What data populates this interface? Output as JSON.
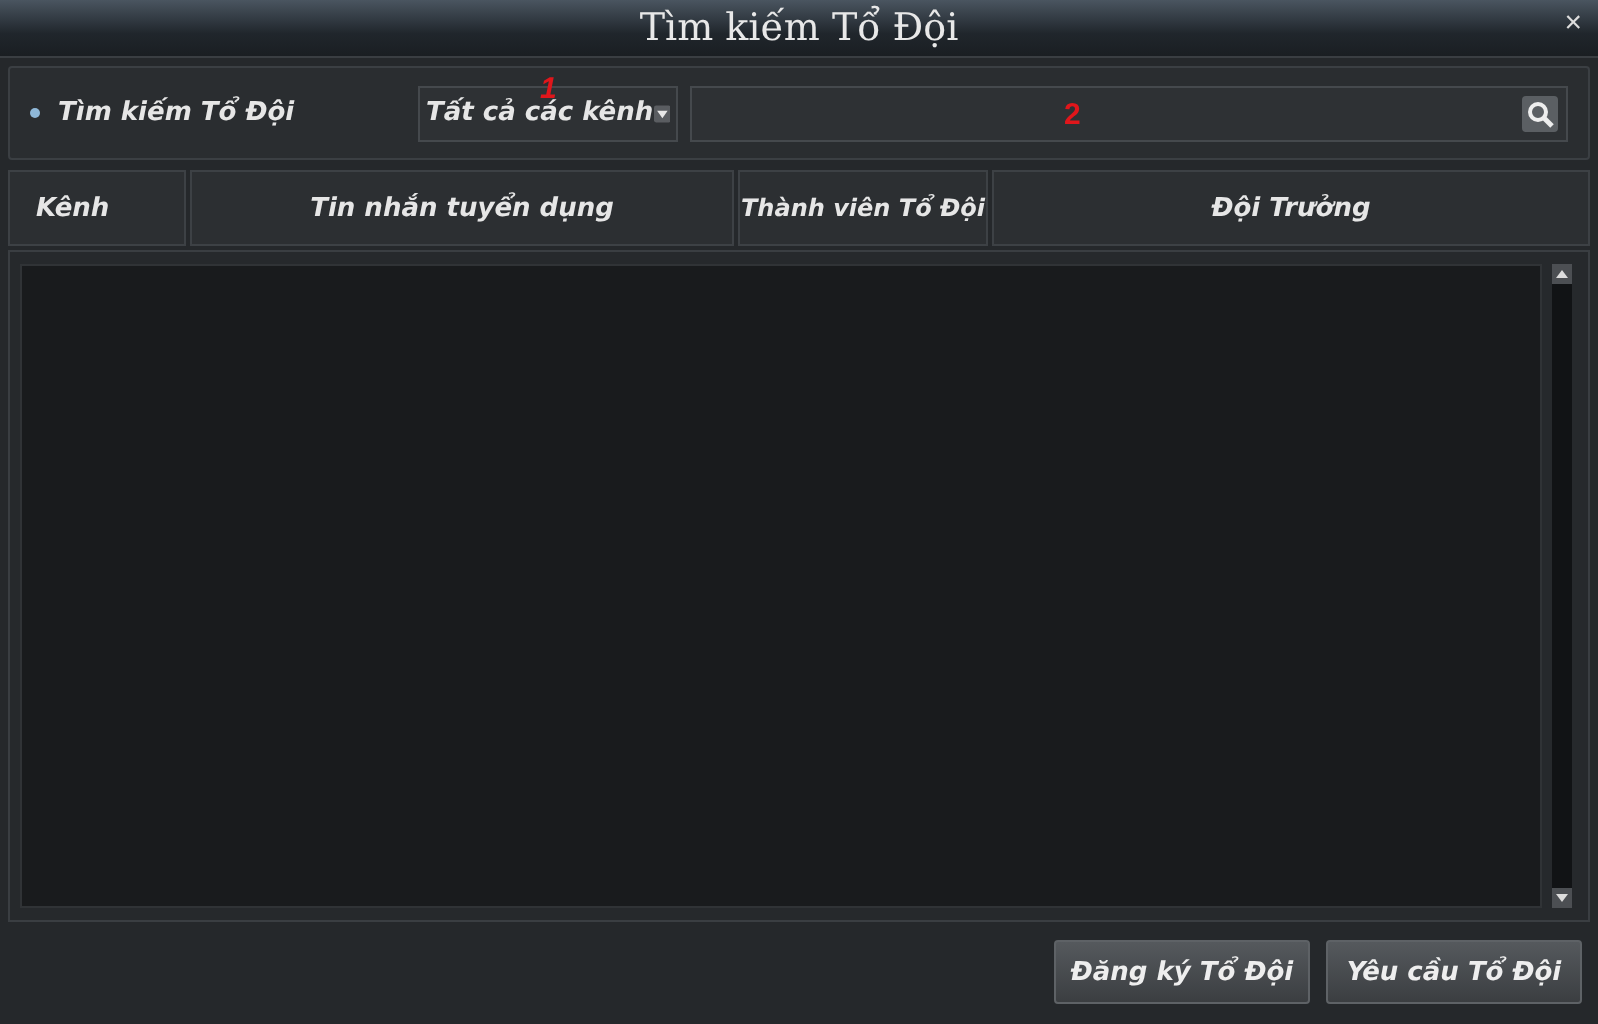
{
  "window": {
    "title": "Tìm kiếm Tổ Đội",
    "close": "×"
  },
  "search": {
    "label": "Tìm kiếm Tổ Đội",
    "channel_dropdown": {
      "value": "Tất cả các kênh"
    }
  },
  "table": {
    "columns": [
      "Kênh",
      "Tin nhắn tuyển dụng",
      "Thành viên Tổ Đội",
      "Đội Trưởng"
    ]
  },
  "buttons": [
    "Đăng ký Tổ Đội",
    "Yêu cầu Tổ Đội"
  ],
  "annotations": [
    "1",
    "2"
  ]
}
